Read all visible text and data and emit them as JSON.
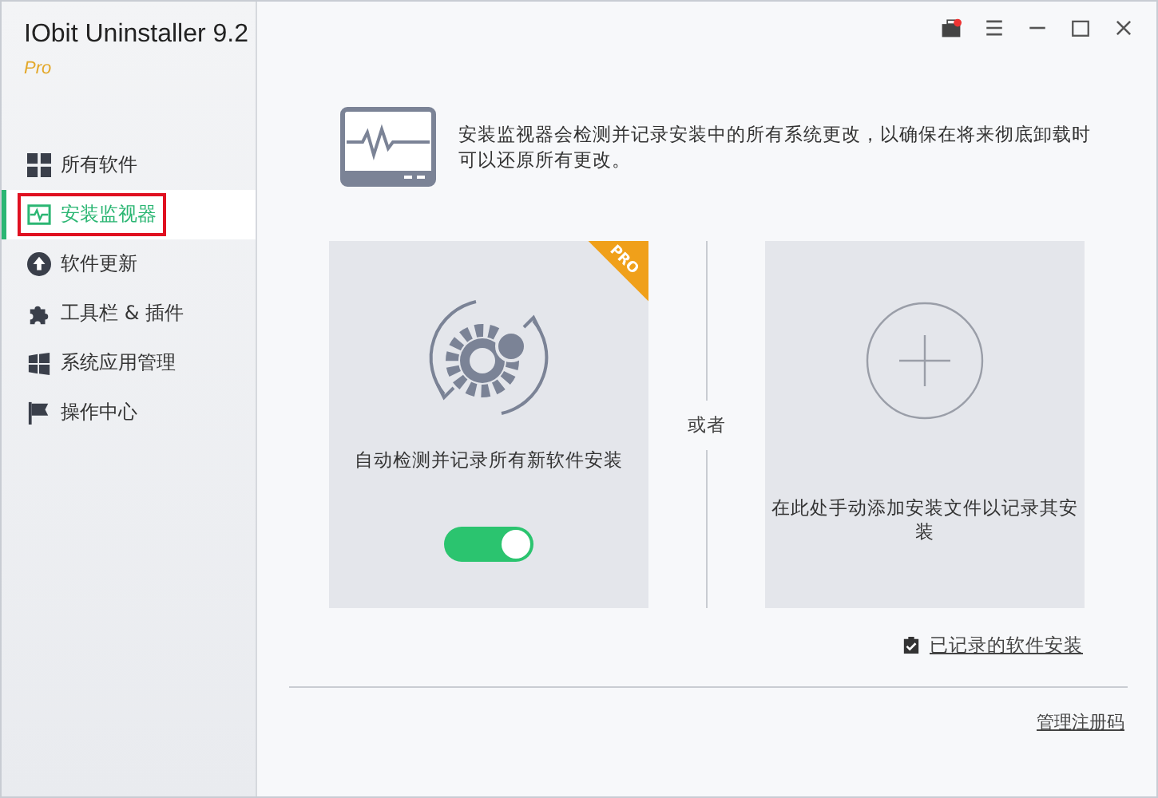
{
  "app": {
    "title": "IObit Uninstaller 9.2",
    "edition": "Pro"
  },
  "sidebar": {
    "items": [
      {
        "label": "所有软件",
        "kind": "grid",
        "selected": false,
        "highlighted": false
      },
      {
        "label": "安装监视器",
        "kind": "monitor",
        "selected": true,
        "highlighted": true
      },
      {
        "label": "软件更新",
        "kind": "upload",
        "selected": false,
        "highlighted": false
      },
      {
        "label": "工具栏 & 插件",
        "kind": "puzzle",
        "selected": false,
        "highlighted": false
      },
      {
        "label": "系统应用管理",
        "kind": "windows",
        "selected": false,
        "highlighted": false
      },
      {
        "label": "操作中心",
        "kind": "flag",
        "selected": false,
        "highlighted": false
      }
    ]
  },
  "intro": "安装监视器会检测并记录安装中的所有系统更改，以确保在将来彻底卸载时可以还原所有更改。",
  "cards": [
    {
      "kind": "auto",
      "badge": "PRO",
      "text": "自动检测并记录所有新软件安装",
      "toggle_on": true
    },
    {
      "kind": "manual",
      "text": "在此处手动添加安装文件以记录其安装"
    }
  ],
  "separator": "或者",
  "recorded_link": "已记录的软件安装",
  "footer_link": "管理注册码"
}
